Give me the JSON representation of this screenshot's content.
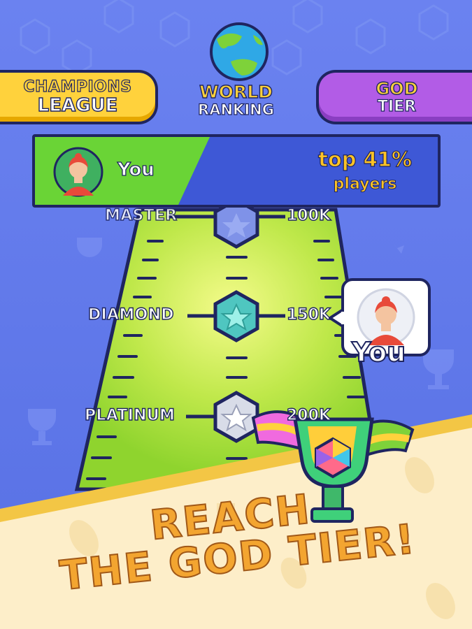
{
  "tabs": [
    {
      "line1": "CHAMPIONS",
      "line2": "LEAGUE"
    },
    {
      "line1": "WORLD",
      "line2": "RANKING"
    },
    {
      "line1": "GOD",
      "line2": "TIER"
    }
  ],
  "player": {
    "name": "You",
    "rank_text": "top 41%",
    "rank_sub": "players"
  },
  "tiers": [
    {
      "name": "MASTER",
      "score": "100K"
    },
    {
      "name": "DIAMOND",
      "score": "150K"
    },
    {
      "name": "PLATINUM",
      "score": "200K"
    }
  ],
  "marker": {
    "label": "You"
  },
  "headline": {
    "line1": "REACH",
    "line2": "THE GOD TIER!"
  },
  "colors": {
    "background": "#5a72e6",
    "banner_green": "#6ad436",
    "tab_yellow": "#ffd23c",
    "tab_purple": "#b25ce6",
    "headline": "#f3a530"
  }
}
